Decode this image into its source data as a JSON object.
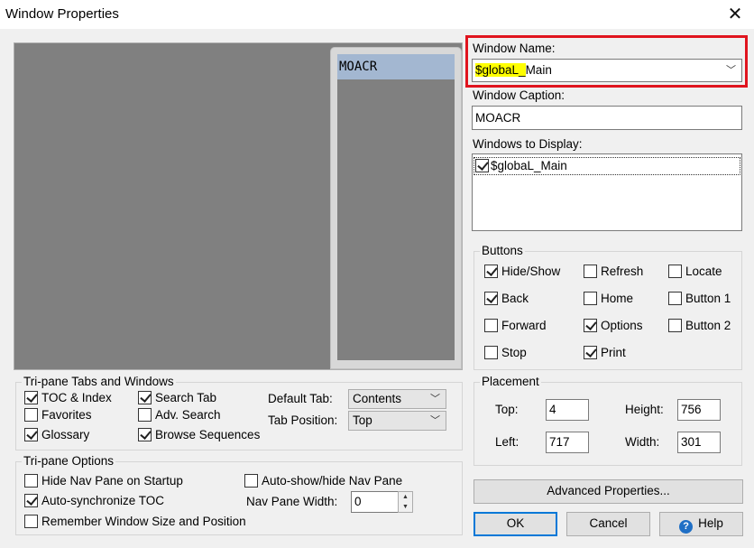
{
  "window": {
    "title": "Window Properties"
  },
  "preview": {
    "caption": "MOACR"
  },
  "window_name": {
    "label": "Window Name:",
    "value_highlight": "$globaL_",
    "value_rest": "Main"
  },
  "window_caption": {
    "label": "Window Caption:",
    "value": "MOACR"
  },
  "windows_to_display": {
    "label": "Windows to Display:",
    "items": [
      {
        "label": "$globaL_Main",
        "checked": true
      }
    ]
  },
  "buttons_group": {
    "label": "Buttons",
    "items": [
      {
        "label": "Hide/Show",
        "checked": true
      },
      {
        "label": "Refresh",
        "checked": false
      },
      {
        "label": "Locate",
        "checked": false
      },
      {
        "label": "Back",
        "checked": true
      },
      {
        "label": "Home",
        "checked": false
      },
      {
        "label": "Button 1",
        "checked": false
      },
      {
        "label": "Forward",
        "checked": false
      },
      {
        "label": "Options",
        "checked": true
      },
      {
        "label": "Button 2",
        "checked": false
      },
      {
        "label": "Stop",
        "checked": false
      },
      {
        "label": "Print",
        "checked": true
      }
    ]
  },
  "placement": {
    "label": "Placement",
    "top_label": "Top:",
    "top_value": "4",
    "height_label": "Height:",
    "height_value": "756",
    "left_label": "Left:",
    "left_value": "717",
    "width_label": "Width:",
    "width_value": "301"
  },
  "tripane_tabs": {
    "label": "Tri-pane Tabs and Windows",
    "items": [
      {
        "label": "TOC & Index",
        "checked": true
      },
      {
        "label": "Search Tab",
        "checked": true
      },
      {
        "label": "Favorites",
        "checked": false
      },
      {
        "label": "Adv. Search",
        "checked": false
      },
      {
        "label": "Glossary",
        "checked": true
      },
      {
        "label": "Browse Sequences",
        "checked": true
      }
    ],
    "default_tab_label": "Default Tab:",
    "default_tab_value": "Contents",
    "tab_position_label": "Tab Position:",
    "tab_position_value": "Top"
  },
  "tripane_options": {
    "label": "Tri-pane Options",
    "hide_nav": {
      "label": "Hide Nav Pane on Startup",
      "checked": false
    },
    "auto_show": {
      "label": "Auto-show/hide Nav Pane",
      "checked": false
    },
    "auto_sync": {
      "label": "Auto-synchronize TOC",
      "checked": true
    },
    "nav_width_label": "Nav Pane Width:",
    "nav_width_value": "0",
    "remember": {
      "label": "Remember Window Size and Position",
      "checked": false
    }
  },
  "actions": {
    "advanced": "Advanced Properties...",
    "ok": "OK",
    "cancel": "Cancel",
    "help": "Help"
  },
  "colors": {
    "accent": "#0078d7",
    "highlight": "#ffff00",
    "callout": "#e0141e"
  }
}
